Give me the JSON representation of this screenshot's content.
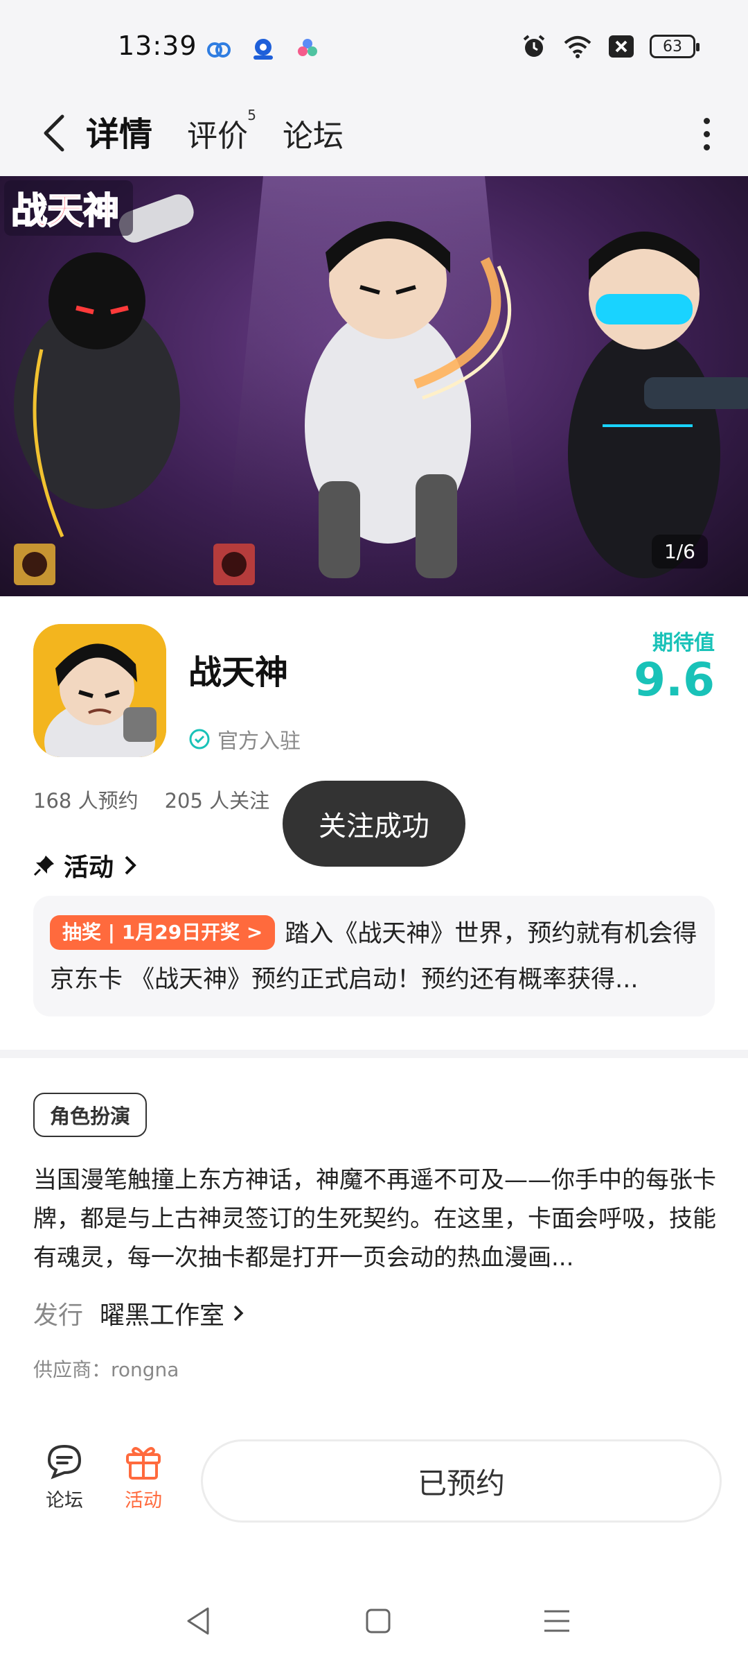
{
  "status_bar": {
    "time": "13:39",
    "battery": "63",
    "icons": [
      "baidu-netdisk-icon",
      "app-shield-icon",
      "app-flower-icon",
      "alarm-icon",
      "wifi-icon",
      "sim-off-icon",
      "battery-icon"
    ]
  },
  "header": {
    "tabs": [
      {
        "label": "详情",
        "active": true
      },
      {
        "label": "评价",
        "badge": "5"
      },
      {
        "label": "论坛"
      }
    ]
  },
  "banner": {
    "logo_text": "战天神",
    "counter": "1/6"
  },
  "app": {
    "name": "战天神",
    "official_label": "官方入驻",
    "expect_label": "期待值",
    "expect_score": "9.6",
    "reservations": "168 人预约",
    "followers": "205 人关注"
  },
  "toast": "关注成功",
  "activity": {
    "title": "活动",
    "tag": "抽奖 | 1月29日开奖 >",
    "text": "踏入《战天神》世界，预约就有机会得京东卡 《战天神》预约正式启动！预约还有概率获得..."
  },
  "genre_tag": "角色扮演",
  "description": "当国漫笔触撞上东方神话，神魔不再遥不可及——你手中的每张卡牌，都是与上古神灵签订的生死契约。在这里，卡面会呼吸，技能有魂灵，每一次抽卡都是打开一页会动的热血漫画...",
  "publisher": {
    "label": "发行",
    "name": "曜黑工作室"
  },
  "supplier": "供应商：rongna",
  "bottom_bar": {
    "forum_label": "论坛",
    "event_label": "活动",
    "reserve_label": "已预约"
  },
  "colors": {
    "accent": "#19c2b8",
    "orange": "#ff6a3d",
    "toast_bg": "#333333"
  }
}
